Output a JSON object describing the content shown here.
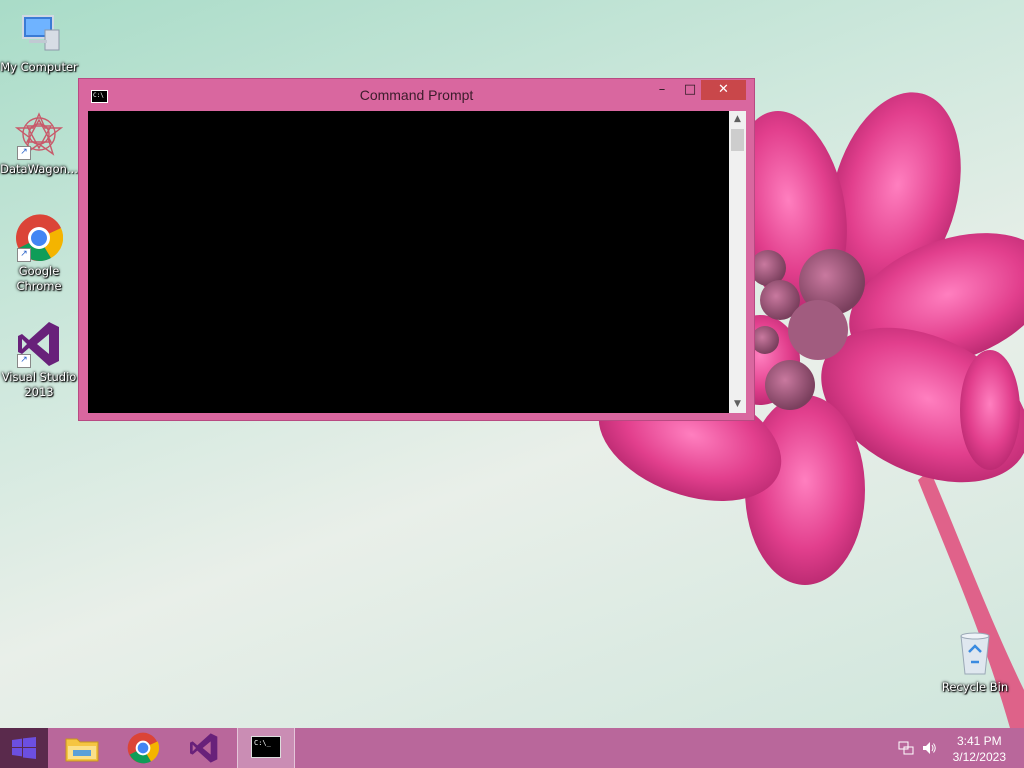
{
  "desktop": {
    "icons": [
      {
        "label": "My Computer",
        "icon": "computer-icon"
      },
      {
        "label": "DataWagon...",
        "icon": "datawagon-icon"
      },
      {
        "label": "Google Chrome",
        "icon": "chrome-icon"
      },
      {
        "label": "Visual Studio 2013",
        "icon": "visual-studio-icon"
      },
      {
        "label": "Recycle Bin",
        "icon": "recycle-bin-icon"
      }
    ]
  },
  "window": {
    "title": "Command Prompt",
    "icon": "cmd-icon",
    "minimize_glyph": "–",
    "maximize_glyph": "□",
    "close_glyph": "✕",
    "console_text": ""
  },
  "taskbar": {
    "items": [
      {
        "name": "file-explorer",
        "icon": "folder-icon"
      },
      {
        "name": "google-chrome",
        "icon": "chrome-icon"
      },
      {
        "name": "visual-studio",
        "icon": "visual-studio-icon"
      },
      {
        "name": "command-prompt",
        "icon": "cmd-icon",
        "active": true
      }
    ],
    "clock_time": "3:41 PM",
    "clock_date": "3/12/2023"
  },
  "colors": {
    "accent": "#d9679f",
    "taskbar": "#b9679b",
    "close": "#c9474a"
  }
}
